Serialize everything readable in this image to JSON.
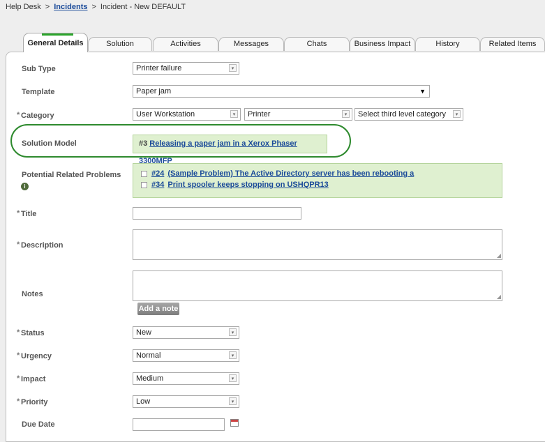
{
  "breadcrumb": {
    "root": "Help Desk",
    "sep1": ">",
    "link": "Incidents",
    "sep2": ">",
    "current": "Incident - New DEFAULT"
  },
  "tabs": [
    {
      "label": "General Details"
    },
    {
      "label": "Solution"
    },
    {
      "label": "Activities"
    },
    {
      "label": "Messages"
    },
    {
      "label": "Chats"
    },
    {
      "label": "Business Impact"
    },
    {
      "label": "History"
    },
    {
      "label": "Related Items"
    }
  ],
  "form": {
    "required_mark": "*",
    "sub_type": {
      "label": "Sub Type",
      "value": "Printer failure"
    },
    "template": {
      "label": "Template",
      "value": "Paper jam"
    },
    "category": {
      "label": "Category",
      "first": "User Workstation",
      "second": "Printer",
      "third": "Select third level category"
    },
    "solution_model": {
      "label": "Solution Model",
      "number": "#3",
      "link": "Releasing a paper jam in a Xerox Phaser 3300MFP"
    },
    "related_problems": {
      "label": "Potential Related Problems",
      "items": [
        {
          "number": "#24",
          "text": "(Sample Problem) The Active Directory server has been rebooting a"
        },
        {
          "number": "#34",
          "text": "Print spooler keeps stopping on USHQPR13"
        }
      ]
    },
    "title": {
      "label": "Title"
    },
    "description": {
      "label": "Description"
    },
    "notes": {
      "label": "Notes",
      "button": "Add a note"
    },
    "status": {
      "label": "Status",
      "value": "New"
    },
    "urgency": {
      "label": "Urgency",
      "value": "Normal"
    },
    "impact": {
      "label": "Impact",
      "value": "Medium"
    },
    "priority": {
      "label": "Priority",
      "value": "Low"
    },
    "due_date": {
      "label": "Due Date"
    }
  },
  "icons": {
    "info": "info-icon",
    "calendar": "calendar-icon",
    "dropdown": "chevron-down-icon"
  },
  "colors": {
    "accent_green": "#2aa52a",
    "highlight_green": "#2e8a2e",
    "suggestion_bg": "#dff0d0",
    "link_blue": "#1a4a99"
  }
}
